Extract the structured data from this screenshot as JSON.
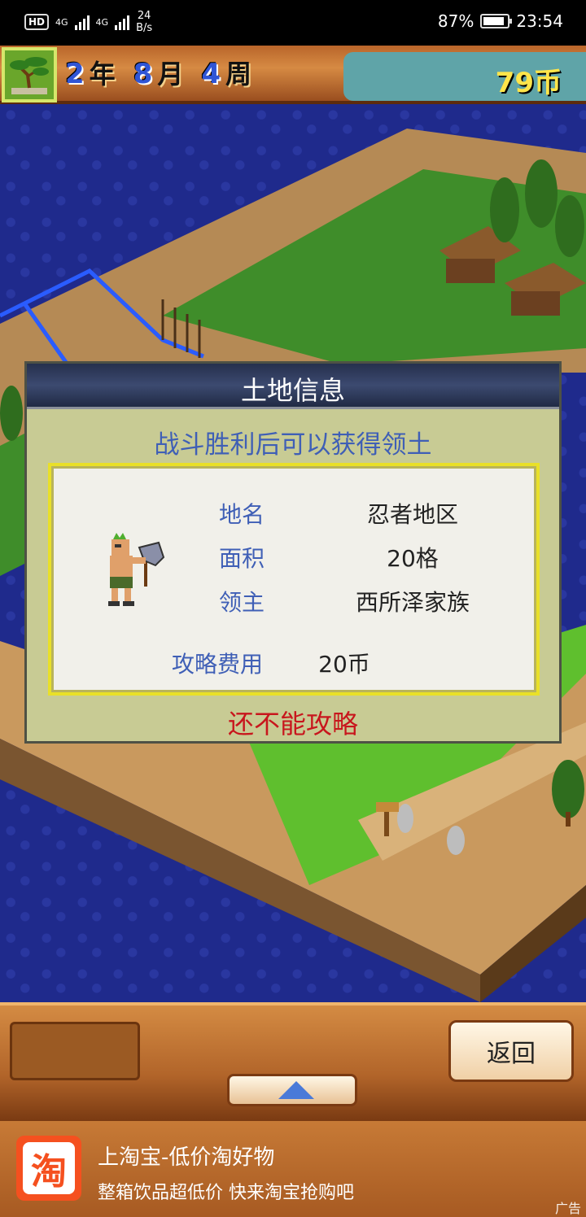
{
  "status_bar": {
    "hd": "HD",
    "signal1": "4G",
    "signal2": "4G",
    "speed_value": "24",
    "speed_unit": "B/s",
    "battery": "87%",
    "time": "23:54"
  },
  "game_header": {
    "year_num": "2",
    "year_unit": "年",
    "month_num": "8",
    "month_unit": "月",
    "week_num": "4",
    "week_unit": "周",
    "coins": "79币"
  },
  "dialog": {
    "title": "土地信息",
    "subtitle": "战斗胜利后可以获得领土",
    "rows": [
      {
        "label": "地名",
        "value": "忍者地区"
      },
      {
        "label": "面积",
        "value": "20格"
      },
      {
        "label": "领主",
        "value": "西所泽家族"
      }
    ],
    "cost_label": "攻略费用",
    "cost_value": "20币",
    "warning": "还不能攻略"
  },
  "bottom_bar": {
    "back_label": "返回"
  },
  "ad": {
    "icon_text": "淘",
    "title": "上淘宝-低价淘好物",
    "description": "整箱饮品超低价 快来淘宝抢购吧",
    "tag": "广告"
  },
  "colors": {
    "water": "#1f2a8c",
    "dialog_bg": "#c8cb94",
    "label_blue": "#3f5fb6",
    "warning_red": "#c8161d",
    "coin_yellow": "#ffe54a"
  }
}
